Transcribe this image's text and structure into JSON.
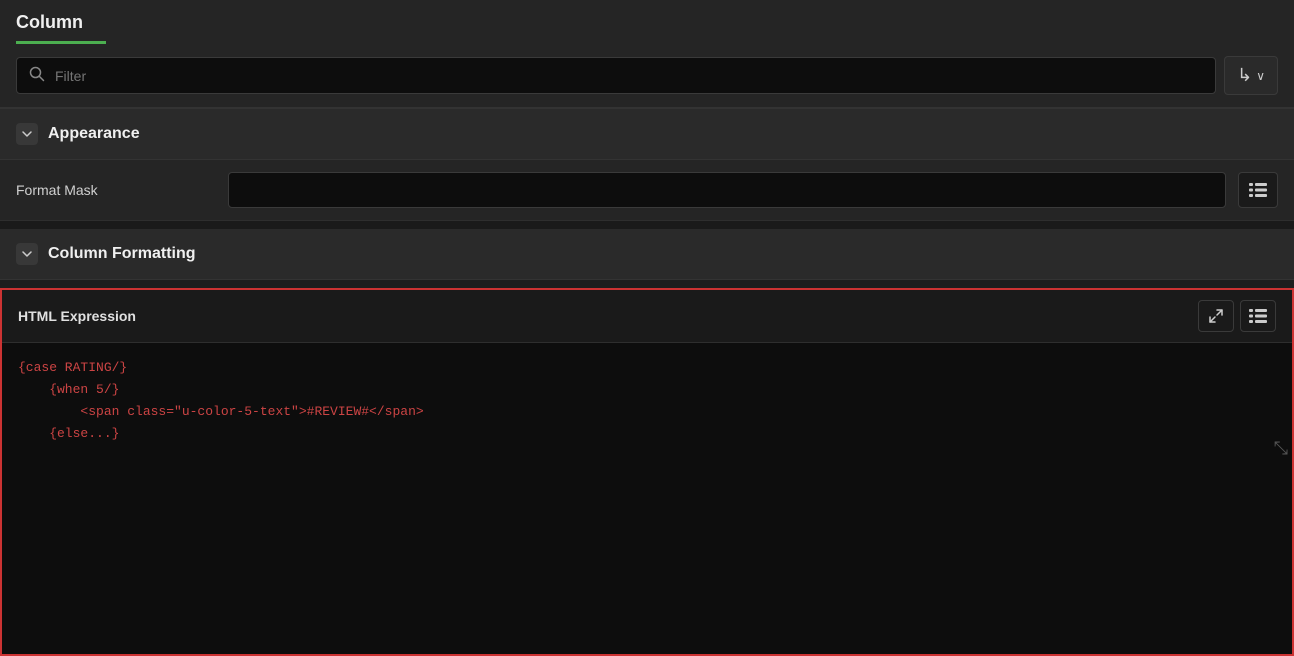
{
  "header": {
    "title": "Column",
    "underline_color": "#4caf50"
  },
  "filter": {
    "placeholder": "Filter",
    "action_icon": "↳∨"
  },
  "appearance_section": {
    "title": "Appearance",
    "collapsed": false
  },
  "format_mask": {
    "label": "Format Mask",
    "value": ""
  },
  "column_formatting_section": {
    "title": "Column Formatting",
    "collapsed": false
  },
  "html_expression": {
    "title": "HTML Expression",
    "code_lines": [
      "{case RATING/}",
      "    {when 5/}",
      "        <span class=\"u-color-5-text\">#REVIEW#</span>",
      "    {else...}"
    ]
  },
  "buttons": {
    "list_icon": "≡",
    "expand_icon": "⤢"
  }
}
